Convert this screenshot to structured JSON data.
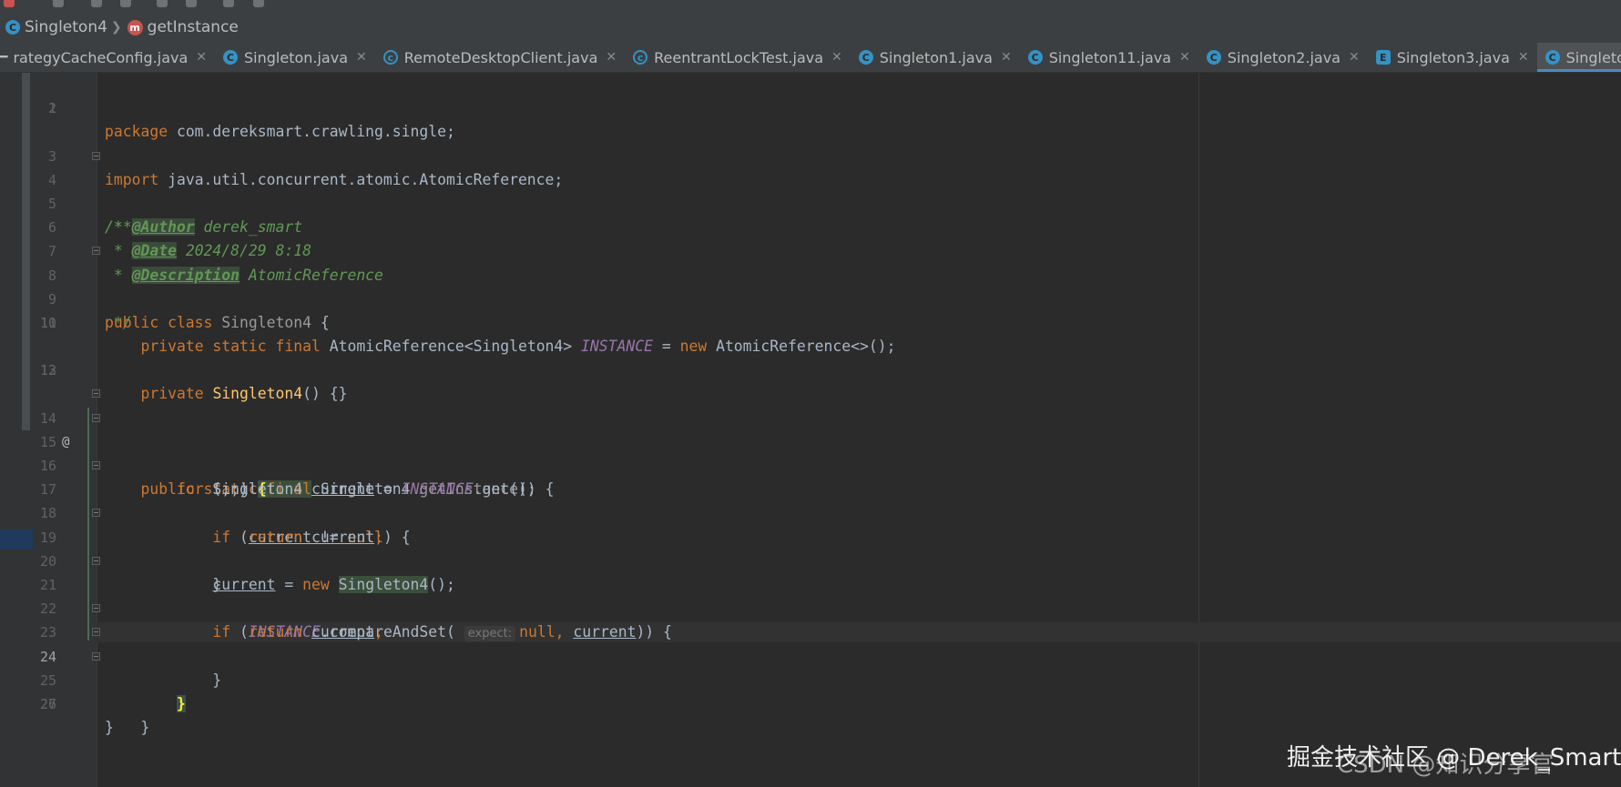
{
  "breadcrumb": {
    "class_label": "Singleton4",
    "method_label": "getInstance"
  },
  "tabs": [
    {
      "label": "rategyCacheConfig.java",
      "icon": "none"
    },
    {
      "label": "Singleton.java",
      "icon": "class-icon"
    },
    {
      "label": "RemoteDesktopClient.java",
      "icon": "class-ring-icon"
    },
    {
      "label": "ReentrantLockTest.java",
      "icon": "class-ring-icon"
    },
    {
      "label": "Singleton1.java",
      "icon": "class-icon"
    },
    {
      "label": "Singleton11.java",
      "icon": "class-icon"
    },
    {
      "label": "Singleton2.java",
      "icon": "class-icon"
    },
    {
      "label": "Singleton3.java",
      "icon": "enum-icon"
    },
    {
      "label": "Singleton4.java",
      "icon": "class-icon",
      "active": true
    }
  ],
  "editor": {
    "current_line": 24,
    "code_text": {
      "pkg_kw": "package",
      "pkg_name": " com.dereksmart.crawling.single;",
      "imp_kw": "import",
      "imp_name": " java.util.concurrent.atomic.AtomicReference;",
      "doc_open": "/**",
      "doc_star": " * ",
      "author_tag": "@Author",
      "author_val": " derek_smart",
      "date_tag": "@Date",
      "date_val": " 2024/8/29 8:18",
      "desc_tag": "@Description",
      "desc_val": " AtomicReference",
      "doc_close": " */",
      "public_class": "public class",
      "class_name": " Singleton4",
      "open_brace": " {",
      "field_mods": "private static final",
      "field_type": " AtomicReference<Singleton4> ",
      "field_name": "INSTANCE",
      "field_eq": " = ",
      "kw_new": "new",
      "field_init": " AtomicReference<>();",
      "private_kw": "private",
      "ctor_name": "Singleton4",
      "ctor_rest": "() {}",
      "public_static": "public static",
      "final_kw": "final",
      "ret_type": " Singleton4 ",
      "method_name": "getInstance",
      "method_rest": "() {",
      "for_kw": "for",
      "for_cond": " (;;) ",
      "brace_open": "{",
      "local_type": "Singleton4 ",
      "var_current": "current",
      "assign": " = ",
      "get_call": ".get();",
      "if_kw": "if",
      "paren_open": " (",
      "neq": " != ",
      "null_kw": "null",
      "if_close": ") {",
      "return_kw": "return",
      "semicolon": ";",
      "close_brace": "}",
      "new_singleton": "Singleton4",
      "new_end": "();",
      "cas_call": ".compareAndSet(",
      "hint_expect": "expect:",
      "comma": ", ",
      "cas_end": ")) {",
      "brace_close_hl": "}"
    }
  },
  "watermark": {
    "line1": "掘金技术社区 @ Derek_Smart",
    "line2": "CSDN @知识分享官"
  },
  "colors": {
    "background": "#2b2b2b",
    "keyword": "#cc7832",
    "static_field": "#9876aa",
    "method": "#ffc66d",
    "doc": "#629755",
    "active_tab_underline": "#4a88c7"
  }
}
